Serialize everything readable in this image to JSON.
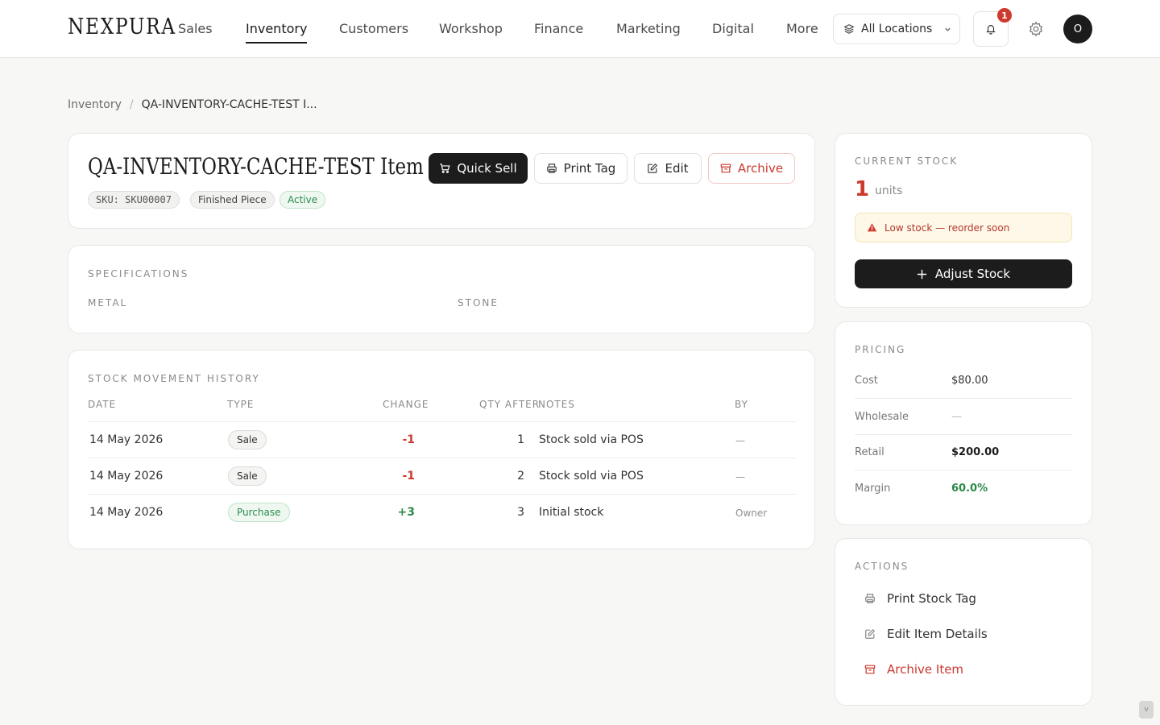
{
  "brand": "NEXPURA",
  "nav": {
    "items": [
      "Sales",
      "Inventory",
      "Customers",
      "Workshop",
      "Finance",
      "Marketing",
      "Digital",
      "More"
    ],
    "active": "Inventory"
  },
  "location": {
    "label": "All Locations",
    "icon": "layers-icon"
  },
  "notifications": {
    "count": "1",
    "icon": "bell-icon"
  },
  "user": {
    "initial": "O"
  },
  "breadcrumb": {
    "parent": "Inventory",
    "separator": "/",
    "current": "QA-INVENTORY-CACHE-TEST I..."
  },
  "item": {
    "title": "QA-INVENTORY-CACHE-TEST Item",
    "sku": "SKU: SKU00007",
    "type": "Finished Piece",
    "status": "Active"
  },
  "header_actions": {
    "quick_sell": "Quick Sell",
    "print_tag": "Print Tag",
    "edit": "Edit",
    "archive": "Archive"
  },
  "specifications": {
    "title": "SPECIFICATIONS",
    "metal_label": "METAL",
    "stone_label": "STONE"
  },
  "history": {
    "title": "STOCK MOVEMENT HISTORY",
    "columns": [
      "DATE",
      "TYPE",
      "CHANGE",
      "QTY AFTER",
      "NOTES",
      "BY"
    ],
    "rows": [
      {
        "date": "14 May 2026",
        "type": "Sale",
        "change": "-1",
        "qty_after": "1",
        "notes": "Stock sold via POS",
        "by": "—"
      },
      {
        "date": "14 May 2026",
        "type": "Sale",
        "change": "-1",
        "qty_after": "2",
        "notes": "Stock sold via POS",
        "by": "—"
      },
      {
        "date": "14 May 2026",
        "type": "Purchase",
        "change": "+3",
        "qty_after": "3",
        "notes": "Initial stock",
        "by": "Owner"
      }
    ]
  },
  "stock": {
    "title": "CURRENT STOCK",
    "quantity": "1",
    "unit": "units",
    "warning": "Low stock — reorder soon",
    "adjust_label": "Adjust Stock"
  },
  "pricing": {
    "title": "PRICING",
    "rows": [
      {
        "label": "Cost",
        "value": "$80.00"
      },
      {
        "label": "Wholesale",
        "value": "—"
      },
      {
        "label": "Retail",
        "value": "$200.00"
      },
      {
        "label": "Margin",
        "value": "60.0%"
      }
    ]
  },
  "actions": {
    "title": "ACTIONS",
    "print_stock_tag": "Print Stock Tag",
    "edit_item_details": "Edit Item Details",
    "archive_item": "Archive Item"
  },
  "scroll_hint": "v",
  "colors": {
    "accent_dark": "#1c1c1c",
    "danger": "#cc3a2f",
    "success": "#2b8a4a",
    "warning_bg": "#fdf8e7"
  }
}
